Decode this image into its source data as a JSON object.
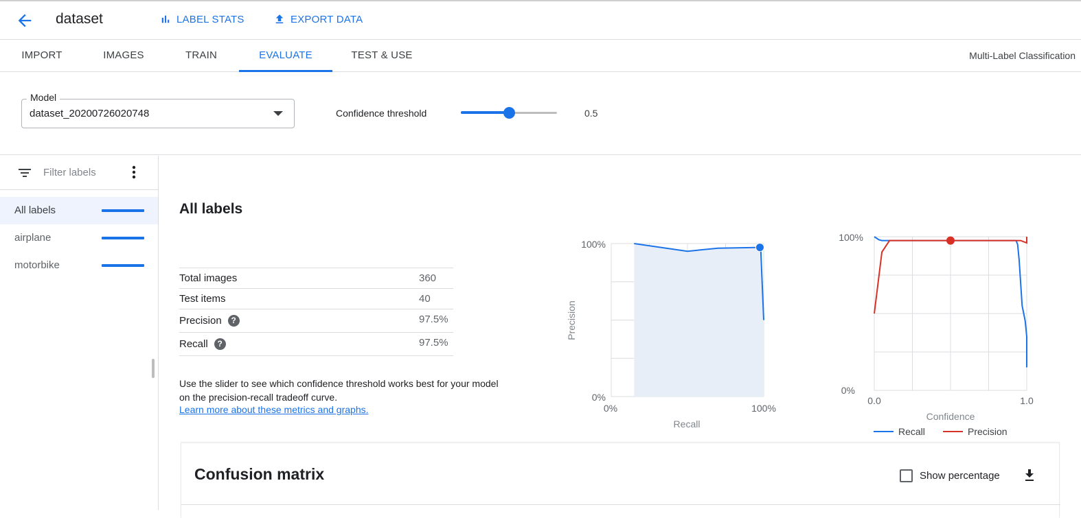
{
  "header": {
    "back_icon": "arrow-back-icon",
    "title": "dataset",
    "buttons": [
      {
        "label": "LABEL STATS",
        "icon": "bar-chart-icon"
      },
      {
        "label": "EXPORT DATA",
        "icon": "upload-icon"
      }
    ]
  },
  "tabs": [
    {
      "label": "IMPORT"
    },
    {
      "label": "IMAGES"
    },
    {
      "label": "TRAIN"
    },
    {
      "label": "EVALUATE",
      "active": true
    },
    {
      "label": "TEST & USE"
    }
  ],
  "mode_label": "Multi-Label Classification",
  "model": {
    "legend": "Model",
    "value": "dataset_20200726020748"
  },
  "confidence": {
    "label": "Confidence threshold",
    "value": "0.5",
    "level": 0.5
  },
  "sidebar": {
    "filter_placeholder": "Filter labels",
    "labels": [
      {
        "name": "All labels",
        "active": true
      },
      {
        "name": "airplane"
      },
      {
        "name": "motorbike"
      }
    ]
  },
  "main": {
    "section_title": "All labels",
    "stats": [
      {
        "label": "Total images",
        "value": "360",
        "help": false
      },
      {
        "label": "Test items",
        "value": "40",
        "help": false
      },
      {
        "label": "Precision",
        "value": "97.5%",
        "help": true
      },
      {
        "label": "Recall",
        "value": "97.5%",
        "help": true
      }
    ],
    "explain": "Use the slider to see which confidence threshold works best for your model on the precision-recall tradeoff curve.",
    "learn_more": "Learn more about these metrics and graphs."
  },
  "chart_data": [
    {
      "type": "line",
      "xlabel": "Recall",
      "ylabel": "Precision",
      "xlim": [
        0,
        100
      ],
      "ylim": [
        0,
        100
      ],
      "x_ticks": [
        "0%",
        "100%"
      ],
      "y_ticks": [
        "0%",
        "100%"
      ],
      "grid": true,
      "series": [
        {
          "x": [
            15,
            50,
            70,
            97.5,
            98,
            100
          ],
          "y": [
            100,
            95,
            97,
            97.5,
            97.5,
            50
          ]
        }
      ],
      "highlight": {
        "x": 97.5,
        "y": 97.5
      },
      "colors": {
        "line": "#1a73e8",
        "fill": "#e8eef8"
      }
    },
    {
      "type": "line",
      "xlabel": "Confidence",
      "xlim": [
        0,
        1
      ],
      "ylim": [
        0,
        100
      ],
      "x_ticks": [
        "0.0",
        "1.0"
      ],
      "y_ticks": [
        "0%",
        "100%"
      ],
      "grid": true,
      "legend_position": "bottom",
      "series": [
        {
          "name": "Recall",
          "color": "#1a73e8",
          "x": [
            0,
            0.03,
            0.05,
            0.1,
            0.5,
            0.93,
            0.94,
            0.95,
            0.96,
            0.97,
            0.98,
            0.99,
            1.0,
            1.0
          ],
          "y": [
            100,
            98,
            97.5,
            97.5,
            97.5,
            97.5,
            95,
            85,
            70,
            55,
            50,
            45,
            35,
            15
          ]
        },
        {
          "name": "Precision",
          "color": "#d93025",
          "x": [
            0,
            0.05,
            0.1,
            0.5,
            0.96,
            1.0,
            1.0
          ],
          "y": [
            50,
            90,
            97.5,
            97.5,
            97.5,
            96,
            100
          ]
        }
      ],
      "highlight": {
        "x": 0.5,
        "y": 97.5,
        "color": "#d93025"
      }
    }
  ],
  "confusion": {
    "title": "Confusion matrix",
    "show_percentage": "Show percentage",
    "download_icon": "download-icon"
  }
}
